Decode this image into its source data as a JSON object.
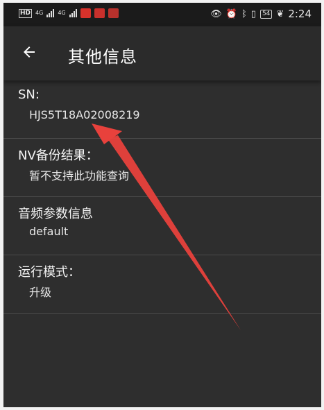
{
  "statusbar": {
    "hd": "HD",
    "net1": "4G",
    "net2": "4G",
    "battery": "54",
    "time": "2:24"
  },
  "header": {
    "title": "其他信息"
  },
  "items": [
    {
      "label": "SN:",
      "value": "HJS5T18A02008219"
    },
    {
      "label": "NV备份结果：",
      "value": "暂不支持此功能查询"
    },
    {
      "label": "音频参数信息",
      "value": "default"
    },
    {
      "label": "运行模式：",
      "value": "升级"
    }
  ],
  "colors": {
    "background": "#2e2e2e",
    "statusbar": "#1b1b1b",
    "divider": "#4a4a4a",
    "annotation_arrow": "#e8413c"
  }
}
